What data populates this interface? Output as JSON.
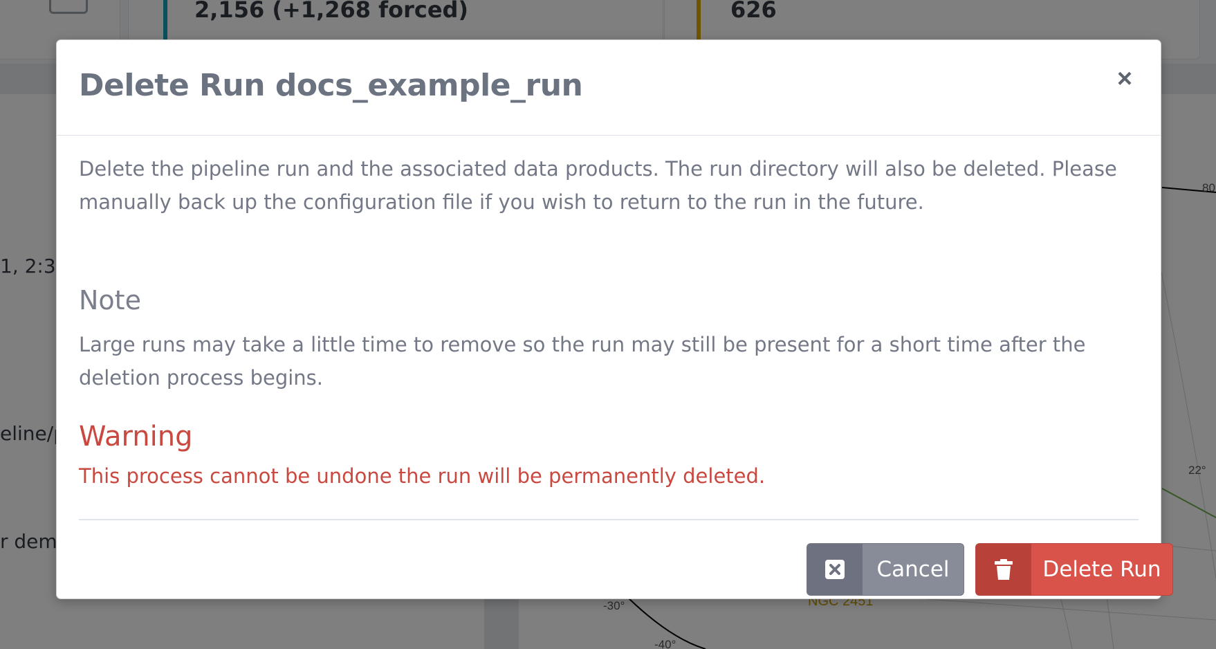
{
  "background": {
    "stat_1": "2,156 (+1,268 forced)",
    "stat_2": "626",
    "left_fragments": [
      "1, 2:3",
      "eline/p",
      "r dem"
    ],
    "sky_ticks": [
      "80",
      "22°",
      "-30°",
      "-40°"
    ],
    "sky_label": "NGC 2451",
    "accent_1": "#17a2b8",
    "accent_2": "#e0a800"
  },
  "modal": {
    "title": "Delete Run docs_example_run",
    "close_glyph": "×",
    "description": "Delete the pipeline run and the associated data products. The run directory will also be deleted. Please manually back up the configuration file if you wish to return to the run in the future.",
    "note_heading": "Note",
    "note_text": "Large runs may take a little time to remove so the run may still be present for a short time after the deletion process begins.",
    "warning_heading": "Warning",
    "warning_text": "This process cannot be undone the run will be permanently deleted.",
    "buttons": {
      "cancel_label": "Cancel",
      "cancel_icon": "window-close-icon",
      "delete_label": "Delete Run",
      "delete_icon": "trash-icon"
    },
    "colors": {
      "warning": "#c9483f",
      "cancel": "#888c99",
      "delete": "#d9534a"
    }
  }
}
